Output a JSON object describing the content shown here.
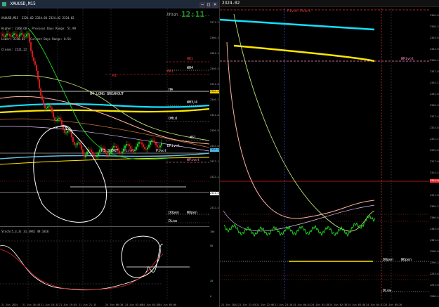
{
  "left_window": {
    "title": "XAUUSD,M15",
    "info_lines": [
      "XAUUSD,M15  2324.02 2324.60 2324.02 2324.02",
      "Higher: 2368.68   Previous Days Range: 51.99",
      "Lower: 2316.65   Current Days Range: 8.54",
      "Closes: 2321.22"
    ],
    "clock": "12:11",
    "labels": {
      "dhigh": "DHigh",
      "wr1": "WR1",
      "wh4": "WH4",
      "dr1": "DR1",
      "h4": "H4",
      "h4_long": "H4 LONG BREAKOUT",
      "wh3_4": "WH3/4",
      "dmid": "DMid",
      "wr1b": "WS1",
      "dpivot": "DPivot",
      "pivot": "Pivot",
      "h3_short": "H3 SHORT",
      "wpivot": "WPivot",
      "dopen": "DOpen",
      "wopen": "WOpen",
      "dlow": "DLow",
      "r1": "R1",
      "pivot_small": "Pivot"
    },
    "price_ticks": [
      "2371.25",
      "2366.35",
      "2361.45",
      "2356.55",
      "2351.65",
      "2346.74",
      "2341.84",
      "2336.94",
      "2332.04",
      "2327.14",
      "2322.24",
      "2317.34",
      "2312.44"
    ],
    "price_tags": [
      {
        "text": "2346.02",
        "color": "#ffd400"
      },
      {
        "text": "2330.02",
        "color": "#4fc3f7"
      },
      {
        "text": "2324.02",
        "color": "#ffffff"
      }
    ],
    "time_ticks": [
      "21 Jun 2024",
      "21 Jun 16:45",
      "21 Jun 18:15",
      "21 Jun 19:45",
      "21 Jun 21:15",
      "24 Jun 00:30",
      "24 Jun 02:00",
      "24 Jun 03:30",
      "24 Jun 05:00"
    ],
    "stoch_title": "Stoch(5,3,3) 31.3941 49.1816",
    "stoch_ticks": [
      "100",
      "80",
      "20",
      "0"
    ]
  },
  "right_window": {
    "labels": {
      "pivot_point": "Pivot Point",
      "wpivot": "WPivot",
      "dopen": "DOpen",
      "wopen": "WOpen",
      "dlow": "DLow"
    },
    "price_ticks": [
      "2350.85",
      "2348.25",
      "2345.65",
      "2343.05",
      "2340.45",
      "2337.85",
      "2335.25",
      "2332.65",
      "2330.05",
      "2327.45",
      "2324.85",
      "2322.25",
      "2319.65",
      "2317.05",
      "2314.45",
      "2311.85",
      "2309.25",
      "2306.65",
      "2304.05",
      "2301.45",
      "2298.85",
      "2296.25",
      "2293.65",
      "2291.05",
      "2288.45"
    ],
    "price_tag": {
      "text": "2324.02",
      "color": "#ff3030"
    },
    "time_ticks": [
      "21 Jun 2024",
      "21 Jun 21:45",
      "21 Jun 22:06",
      "21 Jun 23:10",
      "24 Jun 00:24",
      "24 Jun 01:20",
      "24 Jun 02:36",
      "24 Jun 03:48",
      "24 Jun 04:32",
      "24 Jun 05:26"
    ],
    "header_time": "2324.02"
  },
  "colors": {
    "cyan": "#14e0ff",
    "yellow": "#ffe600",
    "green": "#22dd22",
    "red": "#e02020",
    "white": "#ffffff",
    "pink": "#ff88c8"
  }
}
